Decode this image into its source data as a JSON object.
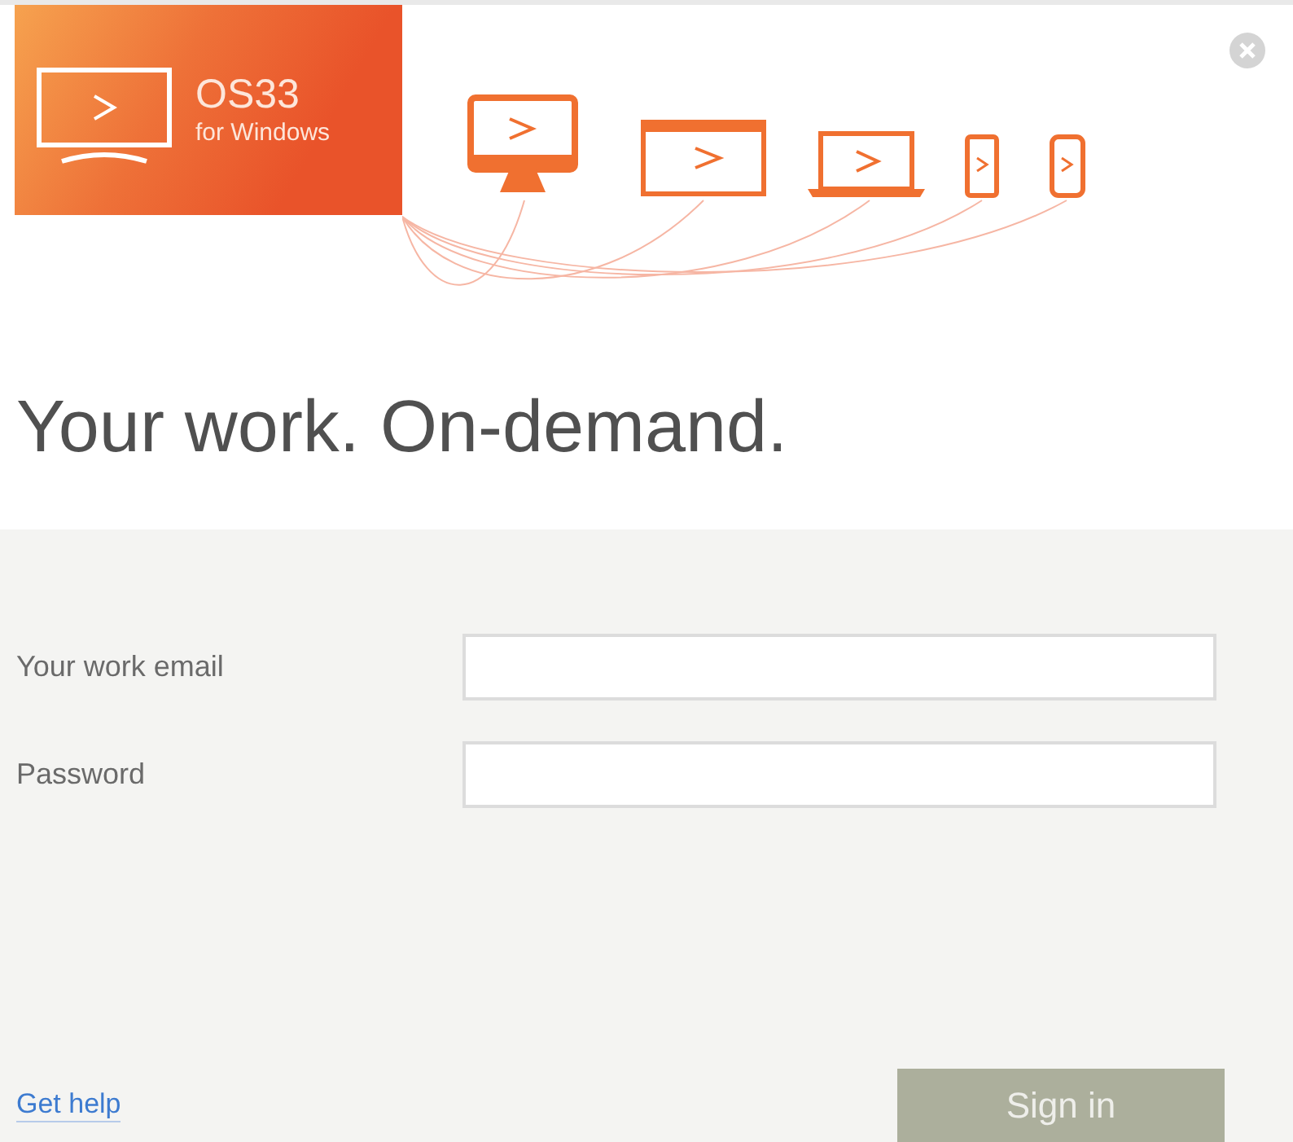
{
  "logo": {
    "title": "OS33",
    "subtitle": "for Windows"
  },
  "headline": "Your work. On-demand.",
  "form": {
    "fields": [
      {
        "label": "Your work email"
      },
      {
        "label": "Password"
      }
    ]
  },
  "help_link": "Get help",
  "sign_in_button": {
    "label": "Sign in",
    "disabled": true
  }
}
